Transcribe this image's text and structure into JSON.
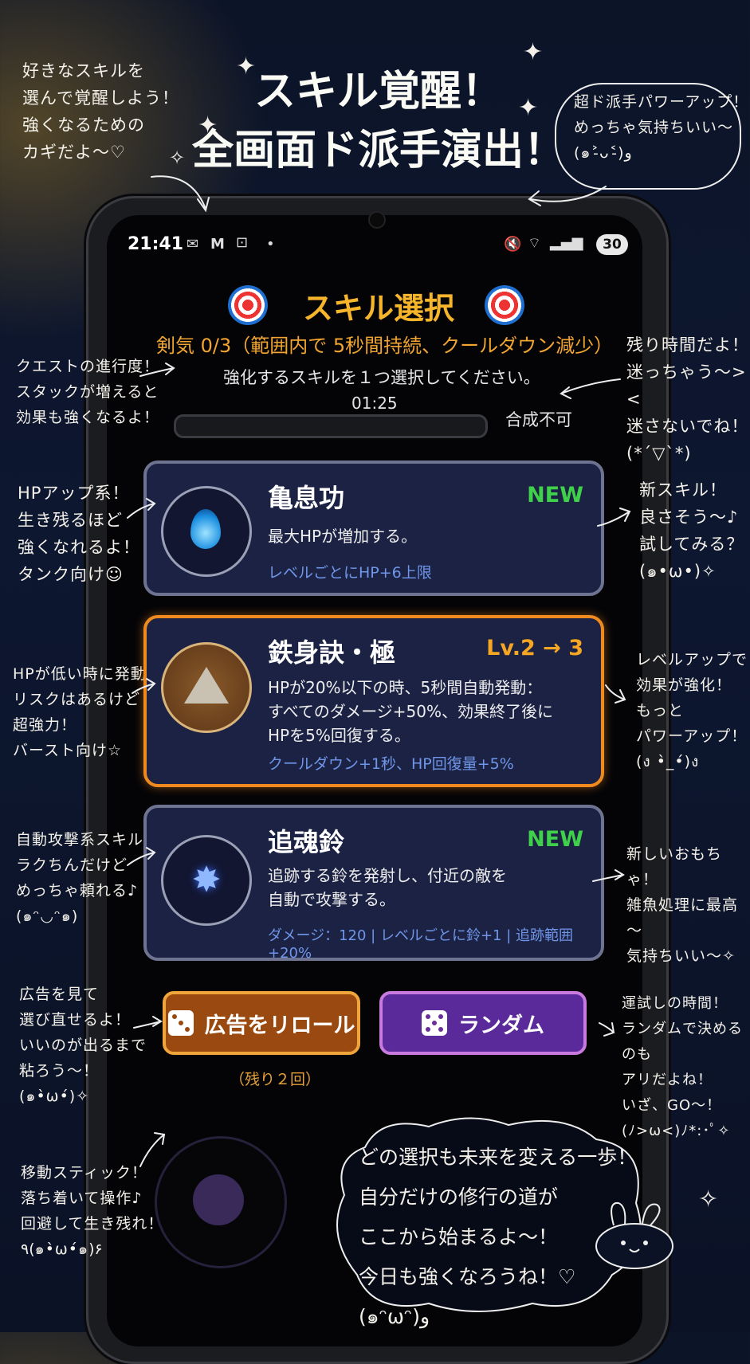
{
  "headline": {
    "line1": "スキル覚醒！",
    "line2": "全画面ド派手演出！"
  },
  "annotations": {
    "top_left": "好きなスキルを\n選んで覚醒しよう！\n強くなるための\nカギだよ～♡",
    "top_right": "超ド派手パワーアップ！\nめっちゃ気持ちいい～\n(๑˃̵ᴗ˂̵)و",
    "quest": "クエストの進行度！\nスタックが増えると\n効果も強くなるよ！",
    "timer": "残り時間だよ！\n迷っちゃう～><\n迷さないでね！\n(*´▽`*)",
    "card1_left": "HPアップ系！\n生き残るほど\n強くなれるよ！\nタンク向け☺",
    "card1_right": "新スキル！\n良さそう～♪\n試してみる？\n(๑•ω•)✧",
    "card2_left": "HPが低い時に発動！\nリスクはあるけど\n超強力！\nバースト向け☆",
    "card2_right": "レベルアップで\n効果が強化！\nもっと\nパワーアップ！\n(ง •̀_•́)ง",
    "card3_left": "自動攻撃系スキル！\nラクちんだけど\nめっちゃ頼れる♪\n(๑ᵔ◡ᵔ๑)",
    "card3_right": "新しいおもちゃ！\n雑魚処理に最高～\n気持ちいい～✧",
    "reroll_left": "広告を見て\n選び直せるよ！\nいいのが出るまで\n粘ろう～！\n(๑•̀ω•́)✧",
    "random_right": "運試しの時間！\nランダムで決めるのも\nアリだよね！\nいざ、GO～！\n(ﾉ>ω<)ﾉ*:･ﾟ✧",
    "stick_left": "移動スティック！\n落ち着いて操作♪\n回避して生き残れ！\n٩(๑•̀ω•́๑)۶",
    "bubble": "どの選択も未来を変える一歩！\n自分だけの修行の道が\nここから始まるよ～！\n今日も強くなろうね！♡\n(๑ᵔωᵔ)و"
  },
  "status_bar": {
    "time": "21:41",
    "battery": "30"
  },
  "game": {
    "title": "スキル選択",
    "quest": "剣気 0/3（範囲内で 5秒間持続、クールダウン減少）",
    "instruction": "強化するスキルを１つ選択してください。",
    "timer": "01:25",
    "merge_status": "合成不可"
  },
  "skills": [
    {
      "name": "亀息功",
      "badge": "NEW",
      "badge_color": "#3fd14a",
      "desc": "最大HPが増加する。",
      "stat": "レベルごとにHP+6上限",
      "icon": "water-drop-icon"
    },
    {
      "name": "鉄身訣・極",
      "badge": "Lv.2 → 3",
      "badge_color": "#f5a623",
      "desc": "HPが20%以下の時、5秒間自動発動：\nすべてのダメージ+50%、効果終了後に\nHPを5%回復する。",
      "stat": "クールダウン+1秒、HP回復量+5%",
      "icon": "pyramid-icon"
    },
    {
      "name": "追魂鈴",
      "badge": "NEW",
      "badge_color": "#3fd14a",
      "desc": "追跡する鈴を発射し、付近の敵を\n自動で攻撃する。",
      "stat": "ダメージ：120 | レベルごとに鈴+1 | 追跡範囲+20%",
      "icon": "star-burst-icon"
    }
  ],
  "buttons": {
    "reroll": "広告をリロール",
    "random": "ランダム",
    "reroll_remaining": "（残り２回）"
  }
}
